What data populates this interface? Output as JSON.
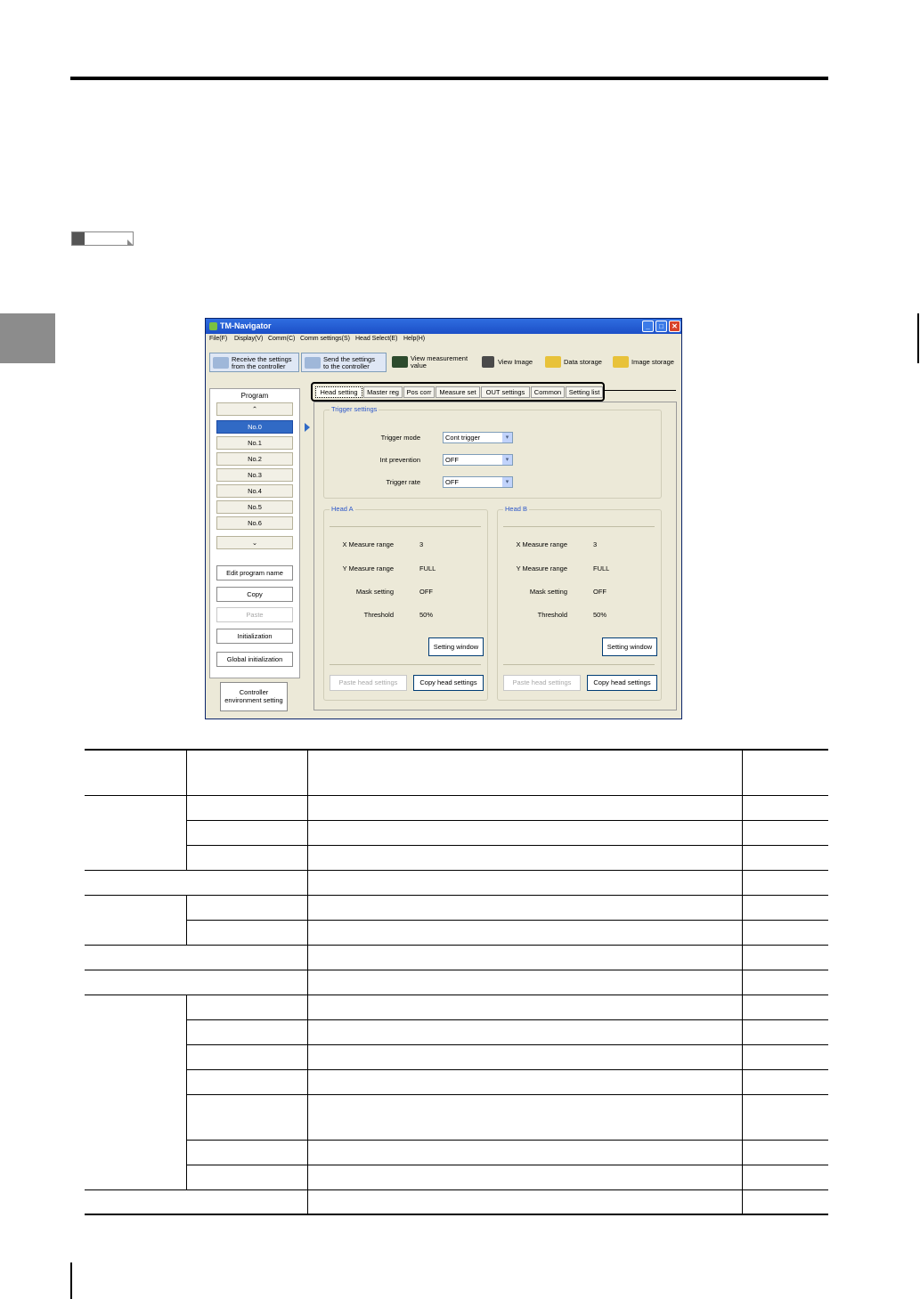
{
  "window": {
    "title": "TM-Navigator",
    "menu": [
      "File(F)",
      "Display(V)",
      "Comm(C)",
      "Comm settings(S)",
      "Head Select(E)",
      "Help(H)"
    ],
    "toolbar": {
      "receive": "Receive the settings\nfrom the controller",
      "send": "Send the settings\nto the controller",
      "view_measurement": "View measurement\nvalue",
      "view_image": "View Image",
      "data_storage": "Data storage",
      "image_storage": "Image storage"
    }
  },
  "program_panel": {
    "title": "Program",
    "scroll_up": "⌃",
    "scroll_down": "⌄",
    "items": [
      "No.0",
      "No.1",
      "No.2",
      "No.3",
      "No.4",
      "No.5",
      "No.6"
    ],
    "selected": "No.0",
    "actions": {
      "edit_name": "Edit program name",
      "copy": "Copy",
      "paste": "Paste",
      "initialization": "Initialization",
      "global_initialization": "Global initialization"
    },
    "controller_env": "Controller\nenvironment setting"
  },
  "tabs": [
    "Head setting",
    "Master reg",
    "Pos corr",
    "Measure set",
    "OUT settings",
    "Common",
    "Setting list"
  ],
  "trigger": {
    "group_title": "Trigger settings",
    "trigger_mode_label": "Trigger mode",
    "trigger_mode_value": "Cont trigger",
    "int_prevention_label": "Int prevention",
    "int_prevention_value": "OFF",
    "trigger_rate_label": "Trigger rate",
    "trigger_rate_value": "OFF"
  },
  "head_a": {
    "title": "Head A",
    "x_range_label": "X Measure range",
    "x_range_value": "3",
    "y_range_label": "Y Measure range",
    "y_range_value": "FULL",
    "mask_label": "Mask setting",
    "mask_value": "OFF",
    "threshold_label": "Threshold",
    "threshold_value": "50%",
    "setting_window": "Setting window",
    "paste_head": "Paste head settings",
    "copy_head": "Copy head settings"
  },
  "head_b": {
    "title": "Head B",
    "x_range_label": "X Measure range",
    "x_range_value": "3",
    "y_range_label": "Y Measure range",
    "y_range_value": "FULL",
    "mask_label": "Mask setting",
    "mask_value": "OFF",
    "threshold_label": "Threshold",
    "threshold_value": "50%",
    "setting_window": "Setting window",
    "paste_head": "Paste head settings",
    "copy_head": "Copy head settings"
  }
}
